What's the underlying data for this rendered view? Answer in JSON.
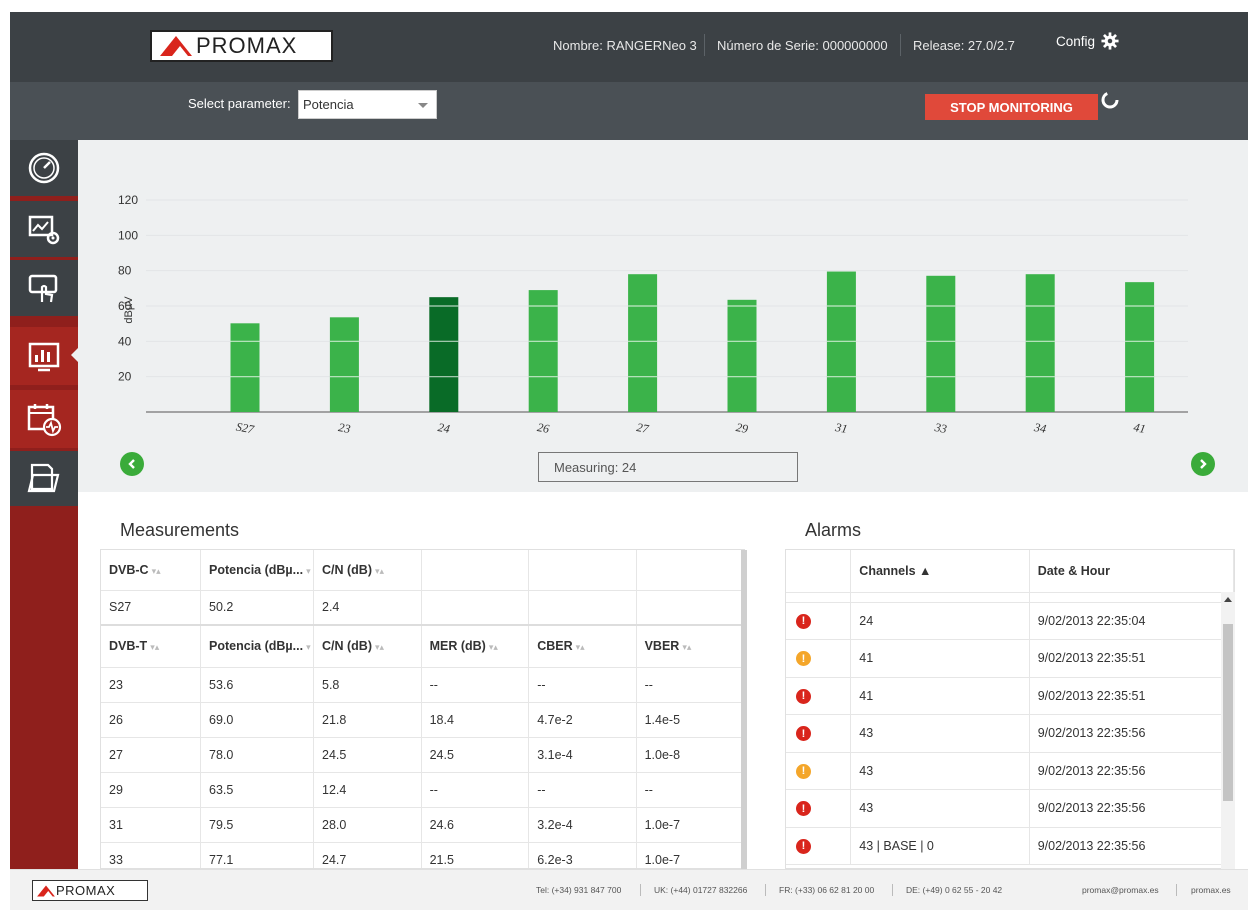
{
  "header": {
    "logo": "PROMAX",
    "device_name": "Nombre: RANGERNeo 3",
    "serial": "Número de Serie: 000000000",
    "release": "Release: 27.0/2.7",
    "config_label": "Config",
    "config_icon": "gear-icon"
  },
  "toolbar": {
    "select_label": "Select parameter:",
    "select_value": "Potencia",
    "stop_label": "STOP MONITORING",
    "spinner_icon": "loading-icon"
  },
  "sidebar": {
    "items": [
      {
        "icon": "gauge-icon"
      },
      {
        "icon": "screen-settings-icon"
      },
      {
        "icon": "touch-screen-icon"
      },
      {
        "icon": "monitoring-chart-icon",
        "active": true
      },
      {
        "icon": "calendar-signal-icon"
      },
      {
        "icon": "folder-icon"
      }
    ]
  },
  "chart_data": {
    "type": "bar",
    "ylabel": "dBµV",
    "ylim": [
      0,
      120
    ],
    "yticks": [
      20,
      40,
      60,
      80,
      100,
      120
    ],
    "categories": [
      "S27",
      "23",
      "24",
      "26",
      "27",
      "29",
      "31",
      "33",
      "34",
      "41"
    ],
    "values": [
      50.2,
      53.6,
      65.0,
      69.0,
      78.0,
      63.5,
      79.5,
      77.1,
      78.0,
      73.5
    ],
    "highlight": "24",
    "colors": {
      "bar": "#3bb34a",
      "highlight": "#096b27"
    },
    "grid": true
  },
  "measuring": "Measuring: 24",
  "measurements": {
    "title": "Measurements",
    "dvbc_header": [
      "DVB-C",
      "Potencia (dBµ...",
      "C/N (dB)",
      "",
      "",
      ""
    ],
    "dvbc_rows": [
      [
        "S27",
        "50.2",
        "2.4",
        "",
        "",
        ""
      ]
    ],
    "dvbt_header": [
      "DVB-T",
      "Potencia (dBµ...",
      "C/N (dB)",
      "MER (dB)",
      "CBER",
      "VBER"
    ],
    "dvbt_rows": [
      [
        "23",
        "53.6",
        "5.8",
        "--",
        "--",
        "--"
      ],
      [
        "26",
        "69.0",
        "21.8",
        "18.4",
        "4.7e-2",
        "1.4e-5"
      ],
      [
        "27",
        "78.0",
        "24.5",
        "24.5",
        "3.1e-4",
        "1.0e-8"
      ],
      [
        "29",
        "63.5",
        "12.4",
        "--",
        "--",
        "--"
      ],
      [
        "31",
        "79.5",
        "28.0",
        "24.6",
        "3.2e-4",
        "1.0e-7"
      ],
      [
        "33",
        "77.1",
        "24.7",
        "21.5",
        "6.2e-3",
        "1.0e-7"
      ]
    ]
  },
  "alarms": {
    "title": "Alarms",
    "header": [
      "",
      "Channels ▲",
      "Date & Hour"
    ],
    "rows": [
      {
        "level": "error",
        "channel": "24",
        "date": "9/02/2013 22:35:04"
      },
      {
        "level": "warning",
        "channel": "41",
        "date": "9/02/2013 22:35:51"
      },
      {
        "level": "error",
        "channel": "41",
        "date": "9/02/2013 22:35:51"
      },
      {
        "level": "error",
        "channel": "43",
        "date": "9/02/2013 22:35:56"
      },
      {
        "level": "warning",
        "channel": "43",
        "date": "9/02/2013 22:35:56"
      },
      {
        "level": "error",
        "channel": "43",
        "date": "9/02/2013 22:35:56"
      },
      {
        "level": "error",
        "channel": "43 | BASE | 0",
        "date": "9/02/2013 22:35:56"
      }
    ]
  },
  "footer": {
    "logo": "PROMAX",
    "tel": "Tel: (+34) 931 847 700",
    "uk": "UK: (+44) 01727 832266",
    "fr": "FR: (+33) 06 62 81 20 00",
    "de": "DE: (+49) 0 62 55 - 20 42",
    "email": "promax@promax.es",
    "web": "promax.es"
  }
}
